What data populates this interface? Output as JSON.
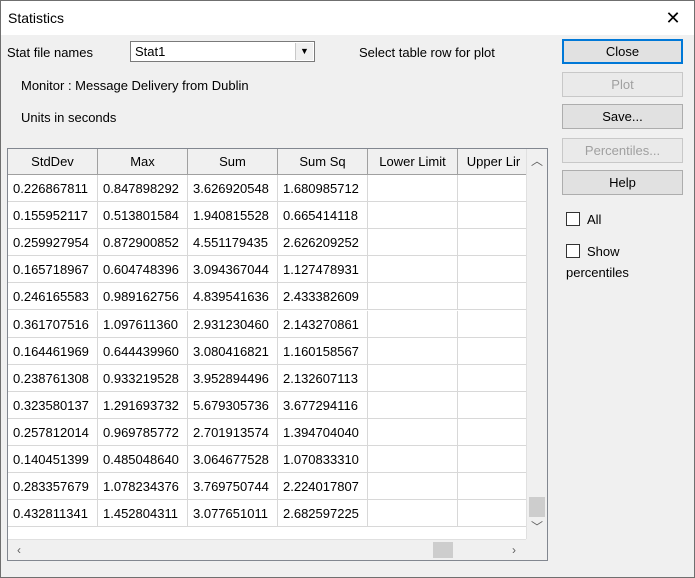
{
  "window": {
    "title": "Statistics"
  },
  "labels": {
    "stat_file_names": "Stat file names",
    "select_hint": "Select table row for plot",
    "monitor": "Monitor : Message Delivery from Dublin",
    "units": "Units in seconds"
  },
  "stat_file": {
    "selected": "Stat1"
  },
  "buttons": {
    "close": "Close",
    "plot": "Plot",
    "save": "Save...",
    "percentiles": "Percentiles...",
    "help": "Help"
  },
  "checkboxes": {
    "all": "All",
    "show": "Show",
    "percentiles": "percentiles"
  },
  "table": {
    "columns": [
      "StdDev",
      "Max",
      "Sum",
      "Sum Sq",
      "Lower Limit",
      "Upper Lir"
    ],
    "rows": [
      [
        "0.226867811",
        "0.847898292",
        "3.626920548",
        "1.680985712",
        "",
        ""
      ],
      [
        "0.155952117",
        "0.513801584",
        "1.940815528",
        "0.665414118",
        "",
        ""
      ],
      [
        "0.259927954",
        "0.872900852",
        "4.551179435",
        "2.626209252",
        "",
        ""
      ],
      [
        "0.165718967",
        "0.604748396",
        "3.094367044",
        "1.127478931",
        "",
        ""
      ],
      [
        "0.246165583",
        "0.989162756",
        "4.839541636",
        "2.433382609",
        "",
        ""
      ],
      [
        "0.361707516",
        "1.097611360",
        "2.931230460",
        "2.143270861",
        "",
        ""
      ],
      [
        "0.164461969",
        "0.644439960",
        "3.080416821",
        "1.160158567",
        "",
        ""
      ],
      [
        "0.238761308",
        "0.933219528",
        "3.952894496",
        "2.132607113",
        "",
        ""
      ],
      [
        "0.323580137",
        "1.291693732",
        "5.679305736",
        "3.677294116",
        "",
        ""
      ],
      [
        "0.257812014",
        "0.969785772",
        "2.701913574",
        "1.394704040",
        "",
        ""
      ],
      [
        "0.140451399",
        "0.485048640",
        "3.064677528",
        "1.070833310",
        "",
        ""
      ],
      [
        "0.283357679",
        "1.078234376",
        "3.769750744",
        "2.224017807",
        "",
        ""
      ],
      [
        "0.432811341",
        "1.452804311",
        "3.077651011",
        "2.682597225",
        "",
        ""
      ]
    ]
  }
}
